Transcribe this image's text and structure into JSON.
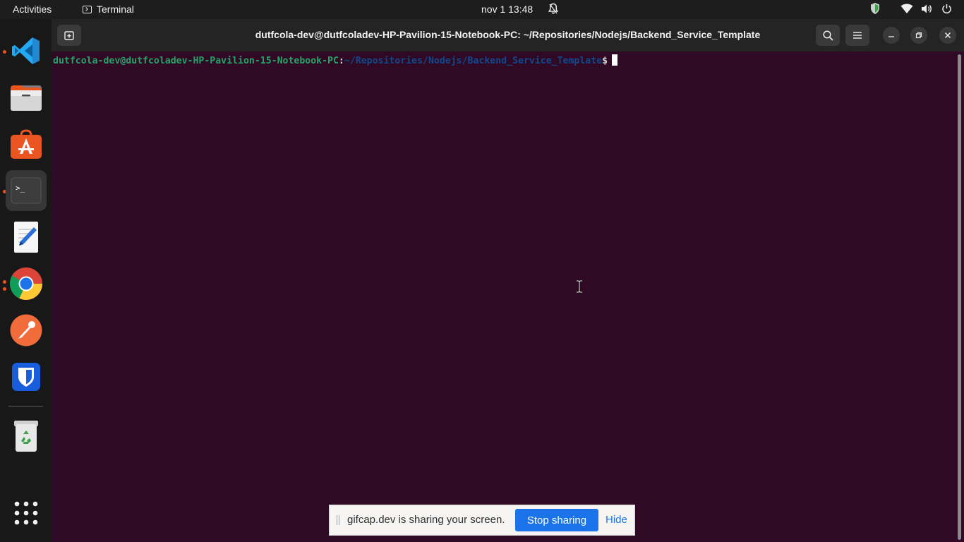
{
  "topbar": {
    "activities": "Activities",
    "app_name": "Terminal",
    "clock": "nov 1  13:48",
    "icons": [
      "bell-icon",
      "shield-icon",
      "wifi-icon",
      "volume-icon",
      "power-icon"
    ]
  },
  "dock": {
    "apps": [
      "vscode",
      "files",
      "ubuntu-software",
      "terminal",
      "text-editor",
      "chrome",
      "postman",
      "bitwarden",
      "trash",
      "show-applications"
    ],
    "active": "terminal"
  },
  "window": {
    "title": "dutfcola-dev@dutfcoladev-HP-Pavilion-15-Notebook-PC: ~/Repositories/Nodejs/Backend_Service_Template",
    "prompt_user": "dutfcola-dev@dutfcoladev-HP-Pavilion-15-Notebook-PC",
    "prompt_colon": ":",
    "prompt_path": "~/Repositories/Nodejs/Backend_Service_Template",
    "prompt_dollar": "$",
    "colors": {
      "background": "#300a24",
      "user": "#26a269",
      "path": "#12488b"
    }
  },
  "share_banner": {
    "message": "gifcap.dev is sharing your screen.",
    "stop_label": "Stop sharing",
    "hide_label": "Hide"
  }
}
